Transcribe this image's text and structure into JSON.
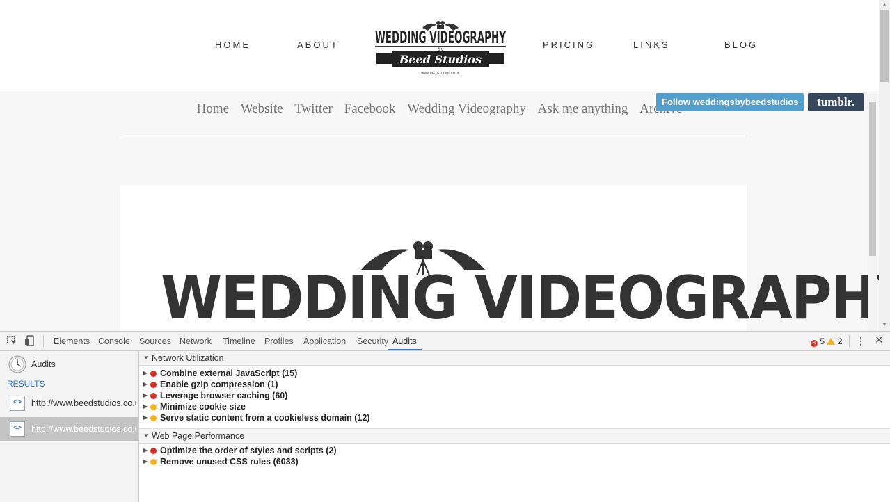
{
  "site_nav": {
    "home": "HOME",
    "about": "ABOUT",
    "pricing": "PRICING",
    "links": "LINKS",
    "blog": "BLOG"
  },
  "logo": {
    "line1": "WEDDING VIDEOGRAPHY",
    "line2": "by",
    "line3": "Beed Studios",
    "line4": "WWW.BEEDSTUDIOS.CO.UK"
  },
  "tumblr_nav": [
    "Home",
    "Website",
    "Twitter",
    "Facebook",
    "Wedding Videography",
    "Ask me anything",
    "Archive"
  ],
  "follow_button": "Follow weddingsbybeedstudios",
  "tumblr_button": "tumblr.",
  "post": {
    "headline": "WEDDING VIDEOGRAPHY"
  },
  "devtools": {
    "tabs": [
      "Elements",
      "Console",
      "Sources",
      "Network",
      "Timeline",
      "Profiles",
      "Application",
      "Security",
      "Audits"
    ],
    "active_tab": "Audits",
    "error_count": "5",
    "warning_count": "2",
    "sidebar": {
      "audits_label": "Audits",
      "results_label": "RESULTS",
      "results": [
        {
          "url": "http://www.beedstudios.co.uk/"
        },
        {
          "url": "http://www.beedstudios.co.uk/"
        }
      ]
    },
    "categories": [
      {
        "title": "Network Utilization",
        "rules": [
          {
            "text": "Combine external JavaScript (15)",
            "severity": "error"
          },
          {
            "text": "Enable gzip compression (1)",
            "severity": "error"
          },
          {
            "text": "Leverage browser caching (60)",
            "severity": "error"
          },
          {
            "text": "Minimize cookie size",
            "severity": "warning"
          },
          {
            "text": "Serve static content from a cookieless domain (12)",
            "severity": "warning"
          }
        ]
      },
      {
        "title": "Web Page Performance",
        "rules": [
          {
            "text": "Optimize the order of styles and scripts (2)",
            "severity": "error"
          },
          {
            "text": "Remove unused CSS rules (6033)",
            "severity": "warning"
          }
        ]
      }
    ],
    "colors": {
      "error": "#d93025",
      "warning": "#f2b21a",
      "active_tab_underline": "#3879d9"
    }
  }
}
